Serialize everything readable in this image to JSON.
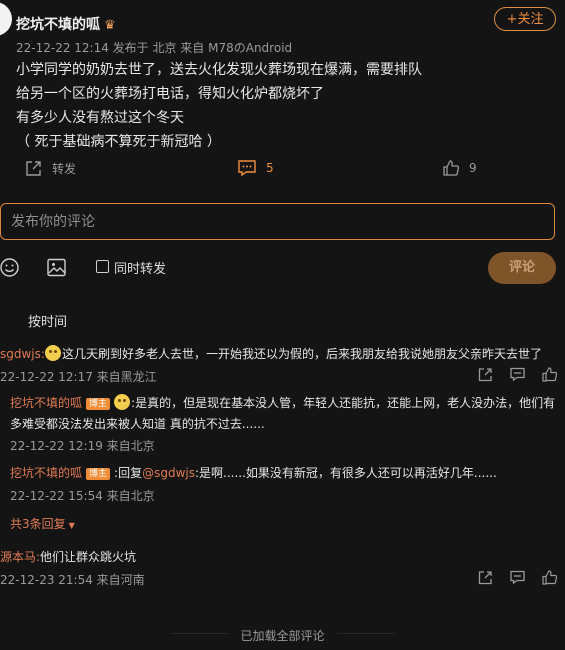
{
  "post": {
    "author": "挖坑不填的呱",
    "meta": "22-12-22 12:14 发布于 北京 来自 M78のAndroid",
    "follow_label": "+关注",
    "lines": [
      "小学同学的奶奶去世了，送去火化发现火葬场现在爆满，需要排队",
      "给另一个区的火葬场打电话，得知火化炉都烧坏了",
      "有多少人没有熬过这个冬天",
      "（ 死于基础病不算死于新冠哈 ）"
    ],
    "repost_label": "转发",
    "comment_count": "5",
    "like_count": "9"
  },
  "composer": {
    "placeholder": "发布你的评论",
    "also_repost_label": "同时转发",
    "submit_label": "评论"
  },
  "sort_label": "按时间",
  "comments": [
    {
      "user": "sgdwjs:",
      "text": "这几天刷到好多老人去世，一开始我还以为假的，后来我朋友给我说她朋友父亲昨天去世了",
      "meta": "22-12-22 12:17 来自黑龙江",
      "replies": [
        {
          "user": "挖坑不填的呱",
          "badge": "博主",
          "text_line1": ":是真的，但是现在基本没人管，年轻人还能抗，还能上网，老人没办法，他们有",
          "text_line2": "多难受都没法发出来被人知道 真的抗不过去......",
          "meta": "22-12-22 12:19 来自北京"
        },
        {
          "user": "挖坑不填的呱",
          "badge": "博主",
          "reply_prefix": ":回复",
          "mention": "@sgdwjs",
          "text": ":是啊......如果没有新冠，有很多人还可以再活好几年......",
          "meta": "22-12-22 15:54 来自北京"
        }
      ],
      "expand_label": "共3条回复"
    },
    {
      "user": "源本马:",
      "text": "他们让群众跳火坑",
      "meta": "22-12-23 21:54 来自河南"
    }
  ],
  "footer": "已加载全部评论",
  "colors": {
    "accent": "#f08f3c",
    "username": "#e07b52",
    "background": "#141414"
  },
  "icons": [
    "repost-icon",
    "comment-icon",
    "like-icon",
    "emoji-icon",
    "image-icon",
    "share-icon",
    "reply-icon",
    "crown-icon"
  ]
}
